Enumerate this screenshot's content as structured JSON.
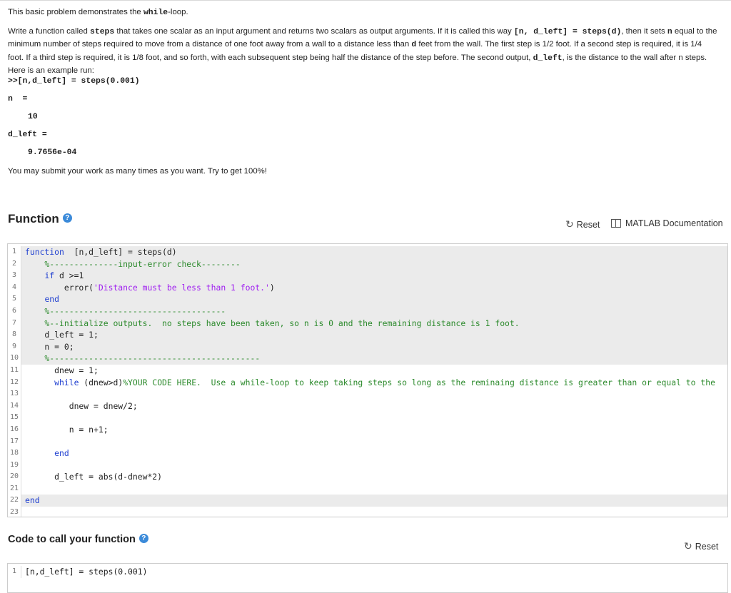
{
  "problem": {
    "intro_pre": "This basic problem demonstrates the ",
    "intro_code": "while",
    "intro_post": "-loop.",
    "p2": {
      "t1": "Write a function called ",
      "c1": "steps",
      "t2": " that takes one scalar as an input argument and returns two scalars as output arguments.  If it is called this way ",
      "c2": "[n, d_left] = steps(d)",
      "t3": ", then it sets ",
      "c3": "n",
      "t4": " equal to the minimum number of steps required to move from a distance of one foot away from a wall to a distance less than ",
      "c4": "d",
      "t5": " feet from the wall.  The first step is 1/2 foot.  If a second step is required, it is 1/4 foot.  If a third step is required, it is 1/8 foot, and so forth, with each subsequent step being half the distance of the step before.  The second output, ",
      "c5": "d_left",
      "t6": ", is the distance to the wall after n steps.  Here is an example run:"
    },
    "example_cmd": ">>[n,d_left] = steps(0.001)",
    "out_n_label": "n  =",
    "out_n_value": "10",
    "out_d_label": "d_left =",
    "out_d_value": "9.7656e-04",
    "closing": "You may submit your work as many times as you want.  Try to get 100%!"
  },
  "function_section": {
    "title": "Function",
    "help_glyph": "?",
    "reset_label": "Reset",
    "doc_label": "MATLAB Documentation"
  },
  "code_lines": [
    {
      "n": "1",
      "ro": true,
      "parts": [
        [
          "kw",
          "function"
        ],
        [
          "",
          "  [n,d_left] = steps(d)"
        ]
      ]
    },
    {
      "n": "2",
      "ro": true,
      "parts": [
        [
          "cm",
          "    %--------------input-error check--------"
        ]
      ]
    },
    {
      "n": "3",
      "ro": true,
      "parts": [
        [
          "",
          "    "
        ],
        [
          "kw",
          "if"
        ],
        [
          "",
          " d >=1"
        ]
      ]
    },
    {
      "n": "4",
      "ro": true,
      "parts": [
        [
          "",
          "        error("
        ],
        [
          "st",
          "'Distance must be less than 1 foot.'"
        ],
        [
          "",
          ")"
        ]
      ]
    },
    {
      "n": "5",
      "ro": true,
      "parts": [
        [
          "",
          "    "
        ],
        [
          "kw",
          "end"
        ]
      ]
    },
    {
      "n": "6",
      "ro": true,
      "parts": [
        [
          "cm",
          "    %------------------------------------"
        ]
      ]
    },
    {
      "n": "7",
      "ro": true,
      "parts": [
        [
          "cm",
          "    %--initialize outputs.  no steps have been taken, so n is 0 and the remaining distance is 1 foot."
        ]
      ]
    },
    {
      "n": "8",
      "ro": true,
      "parts": [
        [
          "",
          "    d_left = 1;"
        ]
      ]
    },
    {
      "n": "9",
      "ro": true,
      "parts": [
        [
          "",
          "    n = 0;"
        ]
      ]
    },
    {
      "n": "10",
      "ro": true,
      "parts": [
        [
          "cm",
          "    %-------------------------------------------"
        ]
      ]
    },
    {
      "n": "11",
      "ro": false,
      "parts": [
        [
          "",
          "      dnew = 1;"
        ]
      ]
    },
    {
      "n": "12",
      "ro": false,
      "parts": [
        [
          "",
          "      "
        ],
        [
          "kw",
          "while"
        ],
        [
          "",
          " (dnew>d)"
        ],
        [
          "cm",
          "%YOUR CODE HERE.  Use a while-loop to keep taking steps so long as the reminaing distance is greater than or equal to the"
        ]
      ]
    },
    {
      "n": "13",
      "ro": false,
      "parts": [
        [
          "",
          ""
        ]
      ]
    },
    {
      "n": "14",
      "ro": false,
      "parts": [
        [
          "",
          "         dnew = dnew/2;"
        ]
      ]
    },
    {
      "n": "15",
      "ro": false,
      "parts": [
        [
          "",
          ""
        ]
      ]
    },
    {
      "n": "16",
      "ro": false,
      "parts": [
        [
          "",
          "         n = n+1;"
        ]
      ]
    },
    {
      "n": "17",
      "ro": false,
      "parts": [
        [
          "",
          ""
        ]
      ]
    },
    {
      "n": "18",
      "ro": false,
      "parts": [
        [
          "",
          "      "
        ],
        [
          "kw",
          "end"
        ]
      ]
    },
    {
      "n": "19",
      "ro": false,
      "parts": [
        [
          "",
          ""
        ]
      ]
    },
    {
      "n": "20",
      "ro": false,
      "parts": [
        [
          "",
          "      d_left = abs(d-dnew*2)"
        ]
      ]
    },
    {
      "n": "21",
      "ro": false,
      "parts": [
        [
          "",
          ""
        ]
      ]
    },
    {
      "n": "22",
      "ro": true,
      "parts": [
        [
          "kw",
          "end"
        ]
      ]
    },
    {
      "n": "23",
      "ro": false,
      "parts": [
        [
          "",
          ""
        ]
      ]
    }
  ],
  "call_section": {
    "title": "Code to call your function",
    "help_glyph": "?",
    "reset_label": "Reset"
  },
  "call_lines": [
    {
      "n": "1",
      "ro": false,
      "parts": [
        [
          "",
          "[n,d_left] = steps(0.001)"
        ]
      ]
    }
  ],
  "colors": {
    "keyword": "#1f3fd0",
    "comment": "#2c8a2c",
    "string": "#a020f0",
    "readonly_bg": "#ebebeb",
    "help_icon": "#3b8ad9"
  },
  "icons": {
    "reset": "rotate-arrow-icon",
    "doc": "book-icon",
    "help": "question-circle-icon"
  }
}
